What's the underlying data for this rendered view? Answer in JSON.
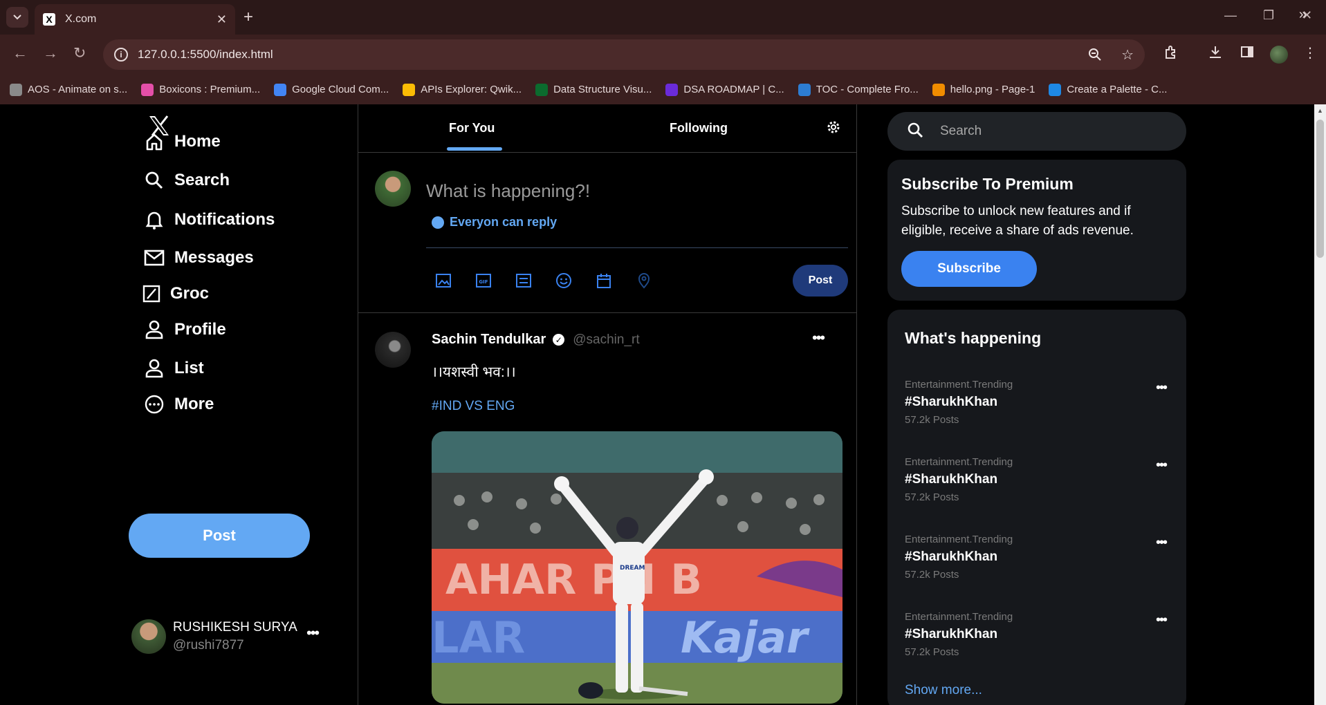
{
  "browser": {
    "tab_title": "X.com",
    "url": "127.0.0.1:5500/index.html",
    "bookmarks": [
      {
        "label": "AOS - Animate on s...",
        "color": "#8a8a8a"
      },
      {
        "label": "Boxicons : Premium...",
        "color": "#e44fa8"
      },
      {
        "label": "Google Cloud Com...",
        "color": "#4285f4"
      },
      {
        "label": "APIs Explorer: Qwik...",
        "color": "#fbbc05"
      },
      {
        "label": "Data Structure Visu...",
        "color": "#0b6b2e"
      },
      {
        "label": "DSA ROADMAP | C...",
        "color": "#6a2bd9"
      },
      {
        "label": "TOC - Complete Fro...",
        "color": "#2d7dd2"
      },
      {
        "label": "hello.png - Page-1",
        "color": "#f08c00"
      },
      {
        "label": "Create a Palette - C...",
        "color": "#1e88e5"
      }
    ]
  },
  "nav": {
    "items": [
      {
        "label": "Home",
        "icon": "home-icon"
      },
      {
        "label": "Search",
        "icon": "search-icon"
      },
      {
        "label": "Notifications",
        "icon": "bell-icon"
      },
      {
        "label": "Messages",
        "icon": "mail-icon"
      },
      {
        "label": "Groc",
        "icon": "groc-icon"
      },
      {
        "label": "Profile",
        "icon": "user-icon"
      },
      {
        "label": "List",
        "icon": "list-user-icon"
      },
      {
        "label": "More",
        "icon": "more-circle-icon"
      }
    ],
    "post_label": "Post",
    "user_name": "RUSHIKESH SURYA",
    "user_handle": "@rushi7877"
  },
  "feed": {
    "tabs": [
      "For You",
      "Following"
    ],
    "composer": {
      "placeholder": "What is happening?!",
      "reply_label": "Everyon can reply",
      "post_label": "Post"
    },
    "tweet": {
      "author": "Sachin Tendulkar",
      "handle": "@sachin_rt",
      "text": "।।यशस्वी भव:।।",
      "hashtag": "#IND VS ENG"
    }
  },
  "sidebar": {
    "search_placeholder": "Search",
    "premium": {
      "heading": "Subscribe To Premium",
      "text": "Subscribe to unlock new features and if eligible, receive a share of ads revenue.",
      "button": "Subscribe"
    },
    "trends_heading": "What's happening",
    "trends": [
      {
        "category": "Entertainment.Trending",
        "tag": "#SharukhKhan",
        "count": "57.2k Posts"
      },
      {
        "category": "Entertainment.Trending",
        "tag": "#SharukhKhan",
        "count": "57.2k Posts"
      },
      {
        "category": "Entertainment.Trending",
        "tag": "#SharukhKhan",
        "count": "57.2k Posts"
      },
      {
        "category": "Entertainment.Trending",
        "tag": "#SharukhKhan",
        "count": "57.2k Posts"
      }
    ],
    "show_more": "Show more..."
  },
  "colors": {
    "accent": "#63a8f3",
    "premium_button": "#3a82f0",
    "card_bg": "#16181c"
  }
}
